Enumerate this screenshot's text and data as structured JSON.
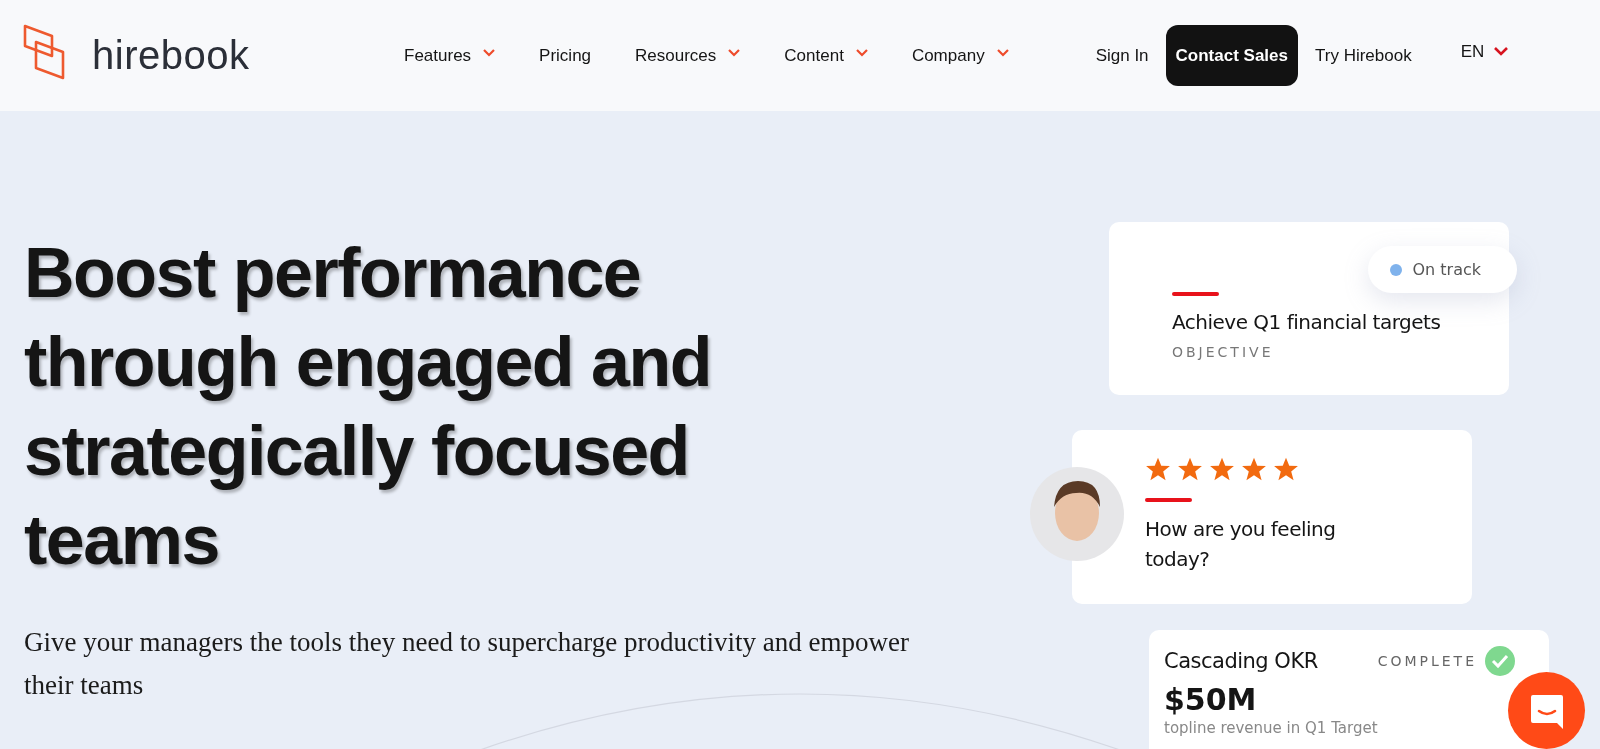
{
  "brand": {
    "name": "hirebook"
  },
  "nav": [
    {
      "label": "Features",
      "has_menu": true
    },
    {
      "label": "Pricing",
      "has_menu": false
    },
    {
      "label": "Resources",
      "has_menu": true
    },
    {
      "label": "Content",
      "has_menu": true
    },
    {
      "label": "Company",
      "has_menu": true
    }
  ],
  "actions": [
    {
      "label": "Sign In",
      "kind": "link"
    },
    {
      "label": "Contact Sales",
      "kind": "primary"
    },
    {
      "label": "Try Hirebook",
      "kind": "link"
    }
  ],
  "language": {
    "label": "EN"
  },
  "hero": {
    "title": "Boost performance through engaged and strategically focused teams",
    "subtitle": "Give your managers the tools they need to supercharge productivity and empower their teams"
  },
  "objective_card": {
    "status": {
      "label": "On track",
      "color": "#7fb2ec"
    },
    "title": "Achieve Q1 financial targets",
    "tag": "OBJECTIVE"
  },
  "feedback_card": {
    "stars": 5,
    "question": "How are you feeling today?"
  },
  "okr_card": {
    "title": "Cascading OKR",
    "status": "COMPLETE",
    "complete": true,
    "value": "$50M",
    "caption": "topline revenue in Q1 Target"
  }
}
